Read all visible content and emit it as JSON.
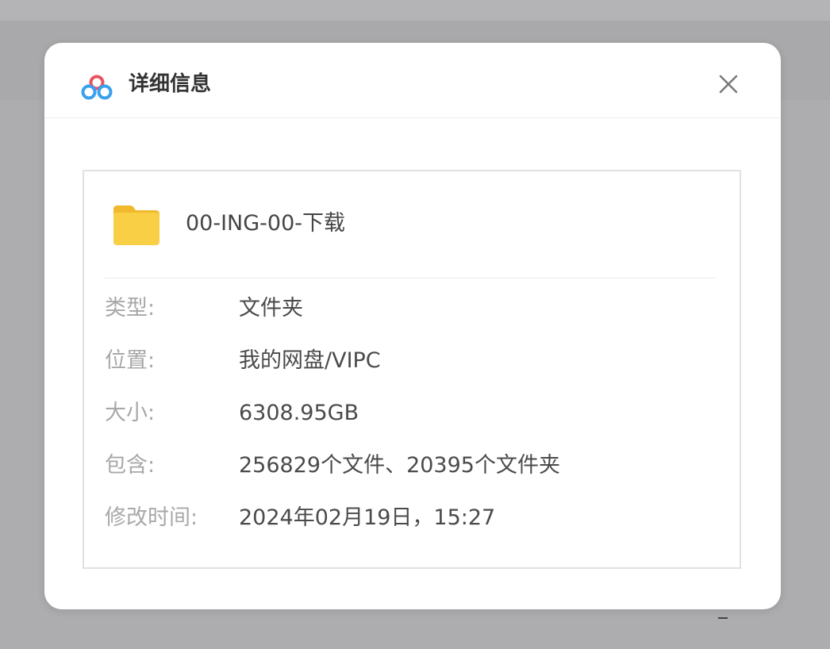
{
  "dialog": {
    "title": "详细信息",
    "logo_icon": "baidu-netdisk-logo-icon",
    "close_icon": "close-icon"
  },
  "file": {
    "icon": "folder-icon",
    "name": "00-ING-00-下载"
  },
  "details": [
    {
      "label": "类型:",
      "value": "文件夹"
    },
    {
      "label": "位置:",
      "value": "我的网盘/VIPC"
    },
    {
      "label": "大小:",
      "value": "6308.95GB"
    },
    {
      "label": "包含:",
      "value": "256829个文件、20395个文件夹"
    },
    {
      "label": "修改时间:",
      "value": "2024年02月19日，15:27"
    }
  ],
  "colors": {
    "logo_blue": "#3aa0f0",
    "logo_red": "#e8545e",
    "folder_yellow": "#f9cf45"
  }
}
